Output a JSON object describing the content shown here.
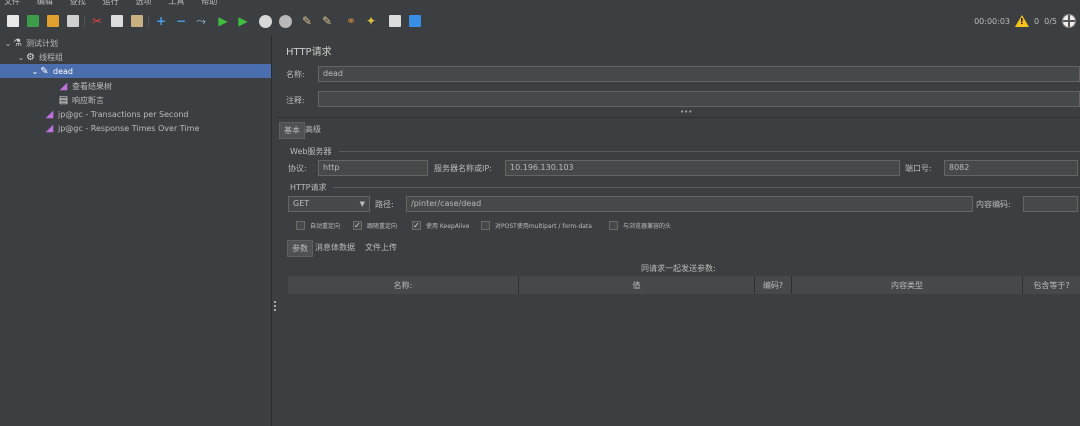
{
  "menu": [
    "文件",
    "编辑",
    "查找",
    "运行",
    "选项",
    "工具",
    "帮助"
  ],
  "status": {
    "time": "00:00:03",
    "warnings": "0",
    "threads": "0/5"
  },
  "tree": {
    "test_plan": "测试计划",
    "thread_group": "线程组",
    "sampler": "dead",
    "view_results": "查看结果树",
    "assertion": "响应断言",
    "tps_listener": "jp@gc - Transactions per Second",
    "rt_listener": "jp@gc - Response Times Over Time"
  },
  "panel": {
    "title": "HTTP请求",
    "name_label": "名称:",
    "name_value": "dead",
    "comment_label": "注释:",
    "comment_value": "",
    "tabs": [
      "基本",
      "高级"
    ],
    "web_server_title": "Web服务器",
    "protocol_label": "协议:",
    "protocol_value": "http",
    "server_label": "服务器名称或IP:",
    "server_value": "10.196.130.103",
    "port_label": "端口号:",
    "port_value": "8082",
    "http_request_title": "HTTP请求",
    "method": "GET",
    "path_label": "路径:",
    "path_value": "/pinter/case/dead",
    "encoding_label": "内容编码:",
    "encoding_value": "",
    "options": [
      {
        "label": "自动重定向",
        "checked": false
      },
      {
        "label": "跟随重定向",
        "checked": true
      },
      {
        "label": "使用 KeepAlive",
        "checked": true
      },
      {
        "label": "对POST使用multipart / form-data",
        "checked": false
      },
      {
        "label": "与浏览器兼容的头",
        "checked": false
      }
    ],
    "param_tabs": [
      "参数",
      "消息体数据",
      "文件上传"
    ],
    "send_params_title": "同请求一起发送参数:",
    "columns": [
      "名称:",
      "值",
      "编码?",
      "内容类型",
      "包含等于?"
    ]
  },
  "colors": {
    "selection": "#4b6eaf",
    "background": "#3c3f41",
    "field": "#45494a"
  }
}
